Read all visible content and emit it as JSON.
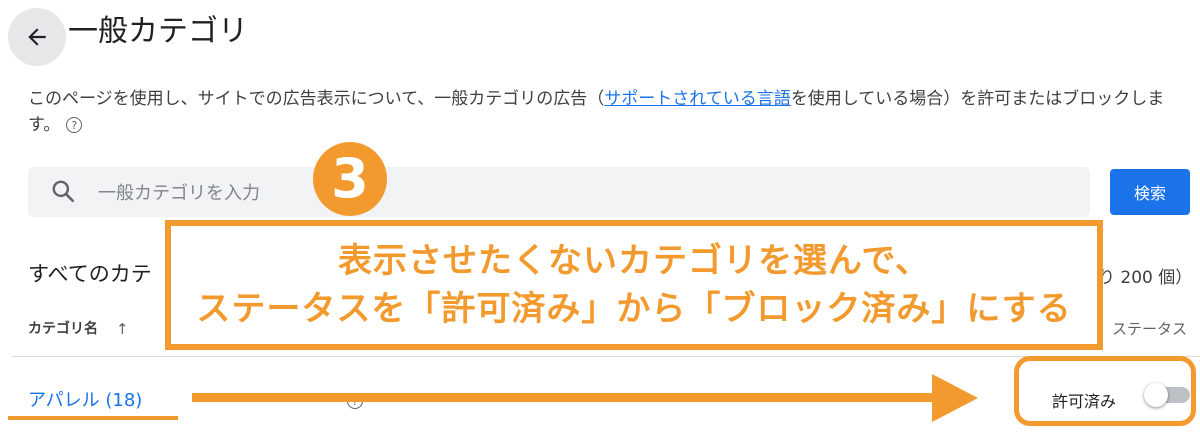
{
  "header": {
    "title": "一般カテゴリ",
    "back_icon": "arrow-left-icon"
  },
  "description": {
    "before_link": "このページを使用し、サイトでの広告表示について、一般カテゴリの広告（",
    "link_text": "サポートされている言語",
    "after_link": "を使用している場合）を許可またはブロックします。",
    "help_icon": "help-circle-icon",
    "help_glyph": "?"
  },
  "search": {
    "placeholder": "一般カテゴリを入力",
    "button_label": "検索",
    "icon": "search-icon"
  },
  "list": {
    "section_title": "すべてのカテ",
    "count_text": "り 200 個）",
    "columns": {
      "name": "カテゴリ名",
      "status": "ステータス",
      "sort_glyph": "↑"
    },
    "rows": [
      {
        "category": "アパレル (18)",
        "status_label": "許可済み",
        "toggle_on": false
      }
    ]
  },
  "annotation": {
    "step_number": "3",
    "line1": "表示させたくないカテゴリを選んで、",
    "line2": "ステータスを「許可済み」から「ブロック済み」にする",
    "accent_color": "#f39a2e"
  },
  "colors": {
    "primary": "#1a73e8",
    "accent": "#f39a2e",
    "search_bg": "#f1f3f4"
  }
}
